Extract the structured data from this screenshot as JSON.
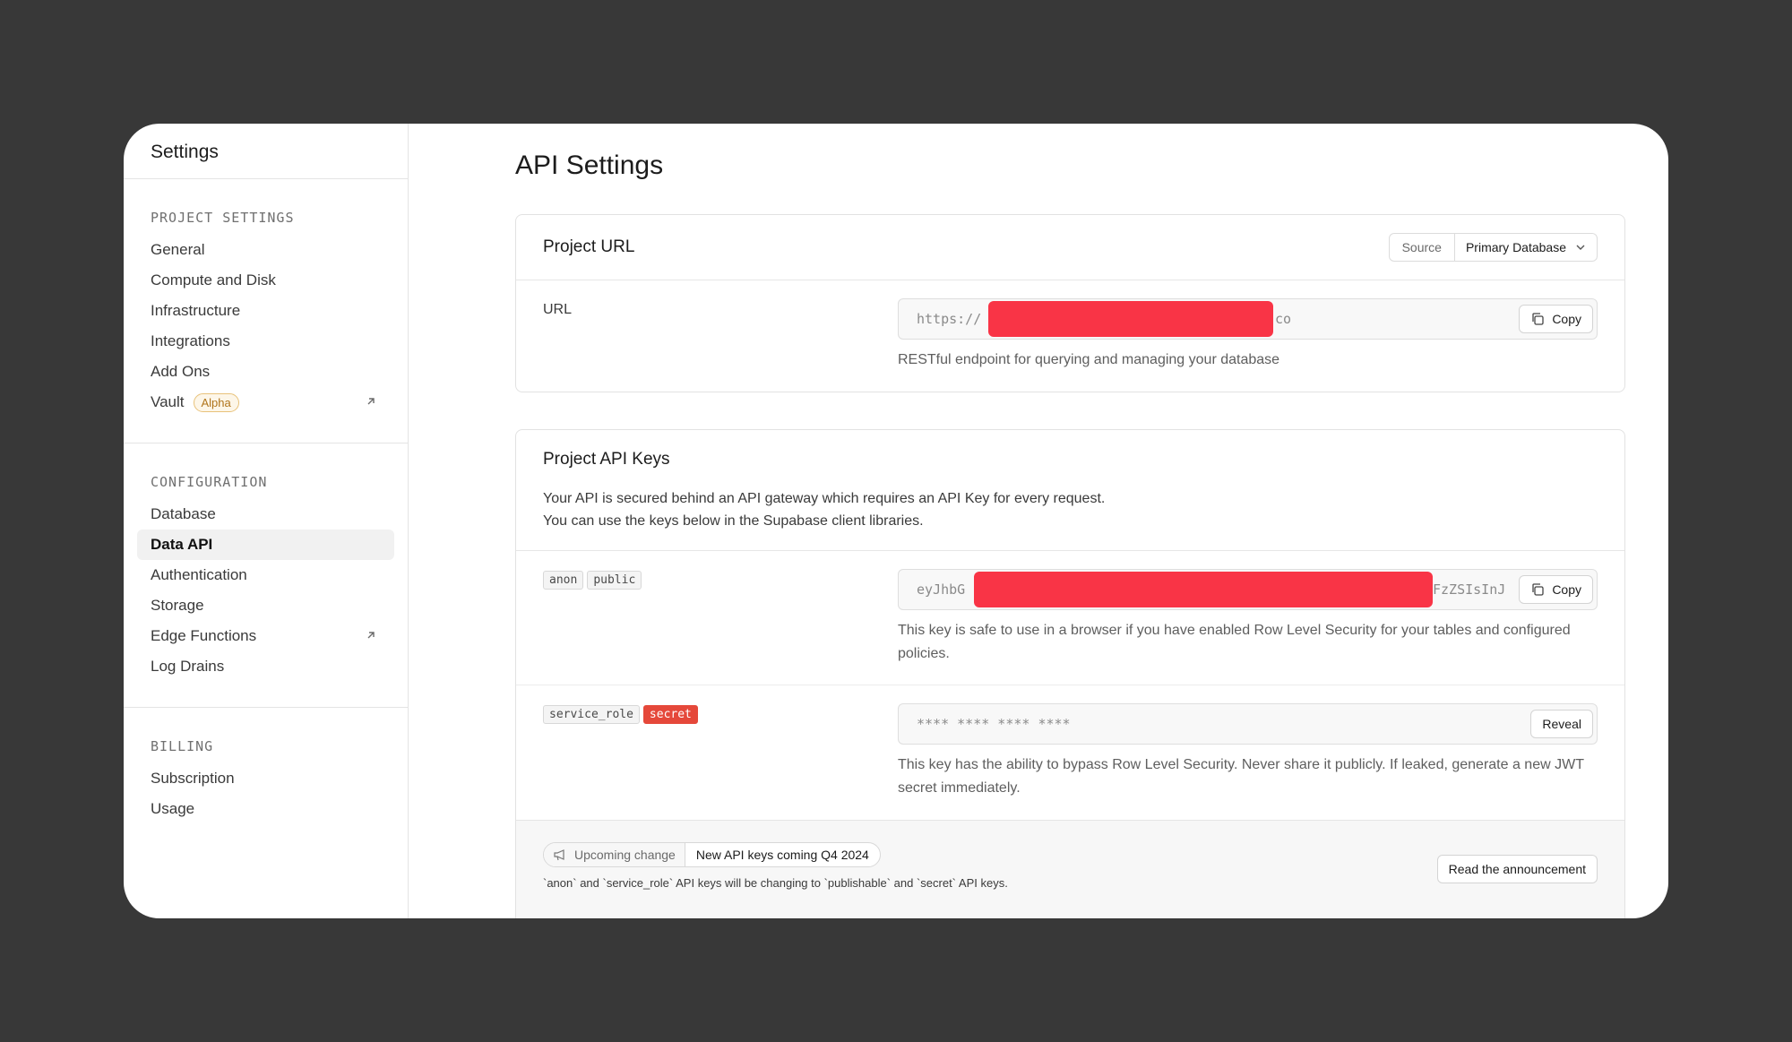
{
  "sidebar": {
    "title": "Settings",
    "sections": [
      {
        "title": "PROJECT SETTINGS",
        "items": [
          {
            "label": "General"
          },
          {
            "label": "Compute and Disk"
          },
          {
            "label": "Infrastructure"
          },
          {
            "label": "Integrations"
          },
          {
            "label": "Add Ons"
          },
          {
            "label": "Vault",
            "badge": "Alpha",
            "external": true
          }
        ]
      },
      {
        "title": "CONFIGURATION",
        "items": [
          {
            "label": "Database"
          },
          {
            "label": "Data API",
            "active": true
          },
          {
            "label": "Authentication"
          },
          {
            "label": "Storage"
          },
          {
            "label": "Edge Functions",
            "external": true
          },
          {
            "label": "Log Drains"
          }
        ]
      },
      {
        "title": "BILLING",
        "items": [
          {
            "label": "Subscription"
          },
          {
            "label": "Usage"
          }
        ]
      }
    ]
  },
  "main": {
    "title": "API Settings",
    "project_url": {
      "title": "Project URL",
      "source_label": "Source",
      "source_value": "Primary Database",
      "url_label": "URL",
      "url_prefix": "https://",
      "url_suffix": "co",
      "copy_label": "Copy",
      "help": "RESTful endpoint for querying and managing your database"
    },
    "api_keys": {
      "title": "Project API Keys",
      "intro_line1": "Your API is secured behind an API gateway which requires an API Key for every request.",
      "intro_line2": "You can use the keys below in the Supabase client libraries.",
      "anon": {
        "tags": [
          "anon",
          "public"
        ],
        "key_prefix": "eyJhbG",
        "key_suffix": "FzZSIsInJ",
        "copy_label": "Copy",
        "help": "This key is safe to use in a browser if you have enabled Row Level Security for your tables and configured policies."
      },
      "service": {
        "tags": [
          "service_role",
          "secret"
        ],
        "masked": "**** **** **** ****",
        "reveal_label": "Reveal",
        "help": "This key has the ability to bypass Row Level Security. Never share it publicly. If leaked, generate a new JWT secret immediately."
      },
      "footer": {
        "pill_left": "Upcoming change",
        "pill_right": "New API keys coming Q4 2024",
        "note": "`anon` and `service_role` API keys will be changing to `publishable` and `secret` API keys.",
        "button": "Read the announcement"
      }
    }
  },
  "colors": {
    "background": "#383838",
    "redaction": "#f93446",
    "secret_tag": "#e5483a",
    "alpha_badge": "#b0741a"
  },
  "icons": [
    "external-link-icon",
    "copy-icon",
    "chevron-down-icon",
    "megaphone-icon"
  ]
}
